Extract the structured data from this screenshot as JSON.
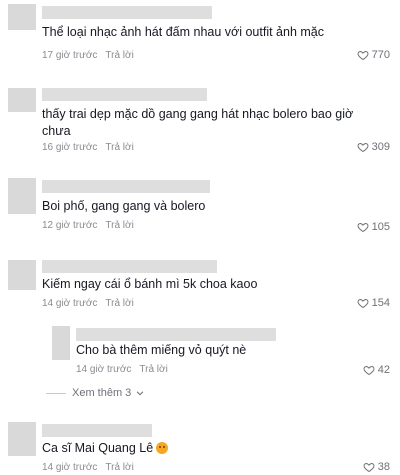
{
  "comments": [
    {
      "text": "Thể loại nhạc ảnh hát đấm nhau với outfit ảnh mặc",
      "time": "17 giờ trước",
      "reply": "Trả lời",
      "likes": "770"
    },
    {
      "text": "thấy trai dẹp mặc dồ gang gang hát nhạc bolero bao giờ chưa",
      "time": "16 giờ trước",
      "reply": "Trả lời",
      "likes": "309"
    },
    {
      "text": "Boi phố, gang gang và bolero",
      "time": "12 giờ trước",
      "reply": "Trả lời",
      "likes": "105"
    },
    {
      "text": "Kiếm ngay cái ổ bánh mì 5k choa kaoo",
      "time": "14 giờ trước",
      "reply": "Trả lời",
      "likes": "154"
    },
    {
      "text": "Cho bà thêm miếng vỏ quýt nè",
      "time": "14 giờ trước",
      "reply": "Trả lời",
      "likes": "42"
    },
    {
      "text": "Ca sĩ Mai Quang Lê",
      "time": "14 giờ trước",
      "reply": "Trả lời",
      "likes": "38",
      "emoji": "grinning-face-emoji"
    }
  ],
  "view_more": "Xem thêm 3",
  "icons": {
    "like": "heart-outline-icon",
    "expand": "chevron-down-icon"
  }
}
